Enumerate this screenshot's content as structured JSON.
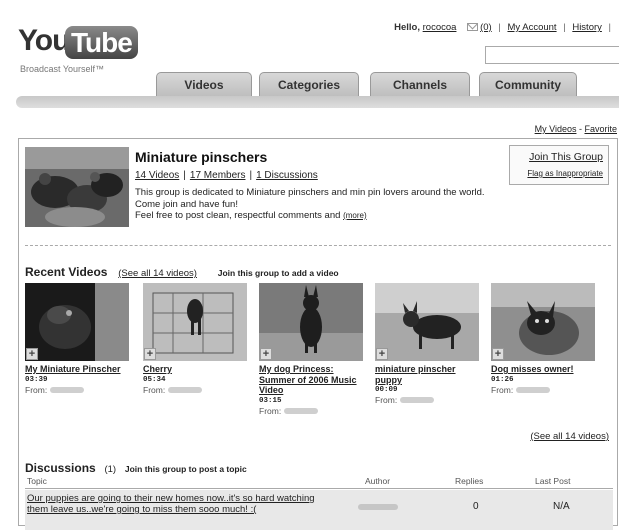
{
  "header": {
    "logo_you": "You",
    "logo_tube": "Tube",
    "tagline": "Broadcast Yourself™",
    "hello": "Hello,",
    "username": "rococoa",
    "mail_count": "(0)",
    "my_account": "My Account",
    "history": "History",
    "search_value": ""
  },
  "tabs": [
    "Videos",
    "Categories",
    "Channels",
    "Community"
  ],
  "subnav": {
    "my_videos": "My Videos",
    "favorites": "Favorite"
  },
  "group": {
    "title": "Miniature pinschers",
    "videos_link": "14 Videos",
    "members_link": "17 Members",
    "discussions_link": "1 Discussions",
    "description_1": "This group is dedicated to Miniature pinschers and min pin lovers around the world.",
    "description_2": "Come join and have fun!",
    "description_3": "Feel free to post clean, respectful comments and",
    "more": "(more)",
    "join_link": "Join This Group",
    "flag_link": "Flag as Inappropriate"
  },
  "recent": {
    "heading": "Recent Videos",
    "see_all": "(See all 14 videos)",
    "join_prompt": "Join this group to add a video",
    "from_label": "From:",
    "see_all_bottom": "(See all 14 videos)",
    "videos": [
      {
        "title": "My Miniature Pinscher",
        "duration": "03:39"
      },
      {
        "title": "Cherry",
        "duration": "05:34"
      },
      {
        "title": "My dog Princess: Summer of 2006 Music Video",
        "duration": "03:15"
      },
      {
        "title": "miniature pinscher puppy",
        "duration": "00:09"
      },
      {
        "title": "Dog misses owner!",
        "duration": "01:26"
      }
    ]
  },
  "discussions": {
    "heading": "Discussions",
    "count": "(1)",
    "join_prompt": "Join this group to post a topic",
    "columns": {
      "topic": "Topic",
      "author": "Author",
      "replies": "Replies",
      "last_post": "Last Post"
    },
    "rows": [
      {
        "topic": "Our puppies are going to their new homes now..it's so hard watching them leave us..we're going to miss them sooo much! :(",
        "replies": "0",
        "last_post": "N/A"
      }
    ]
  },
  "colors": {
    "tab_gradient": "#cfcfcf",
    "accent": "#333333",
    "row_bg": "#e8e8e8"
  }
}
